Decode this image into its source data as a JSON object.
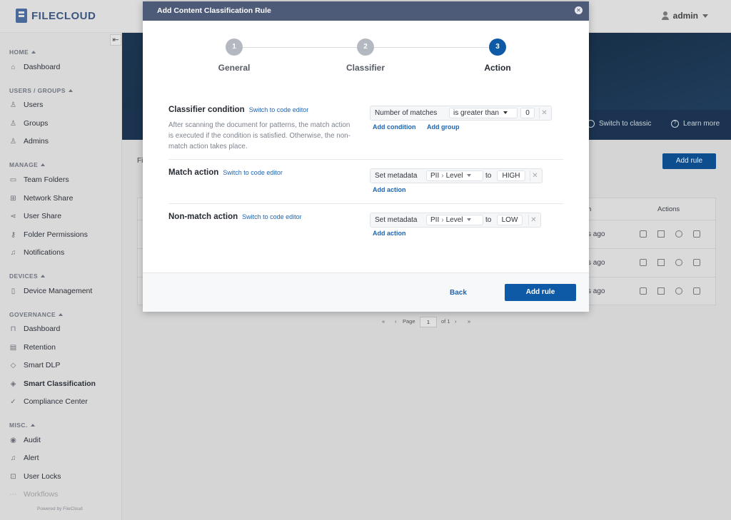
{
  "app": {
    "logo_text": "FILECLOUD",
    "user": "admin"
  },
  "sidebar": {
    "sections": [
      {
        "label": "HOME",
        "items": [
          {
            "label": "Dashboard",
            "icon": "home-icon"
          }
        ]
      },
      {
        "label": "USERS / GROUPS",
        "items": [
          {
            "label": "Users",
            "icon": "user-icon"
          },
          {
            "label": "Groups",
            "icon": "group-icon"
          },
          {
            "label": "Admins",
            "icon": "admin-icon"
          }
        ]
      },
      {
        "label": "MANAGE",
        "items": [
          {
            "label": "Team Folders",
            "icon": "folder-icon"
          },
          {
            "label": "Network Share",
            "icon": "network-icon"
          },
          {
            "label": "User Share",
            "icon": "share-icon"
          },
          {
            "label": "Folder Permissions",
            "icon": "key-icon"
          },
          {
            "label": "Notifications",
            "icon": "bell-icon"
          }
        ]
      },
      {
        "label": "DEVICES",
        "items": [
          {
            "label": "Device Management",
            "icon": "device-icon"
          }
        ]
      },
      {
        "label": "GOVERNANCE",
        "items": [
          {
            "label": "Dashboard",
            "icon": "bank-icon"
          },
          {
            "label": "Retention",
            "icon": "archive-icon"
          },
          {
            "label": "Smart DLP",
            "icon": "shield-icon"
          },
          {
            "label": "Smart Classification",
            "icon": "tag-icon"
          },
          {
            "label": "Compliance Center",
            "icon": "check-icon"
          }
        ]
      },
      {
        "label": "MISC.",
        "items": [
          {
            "label": "Audit",
            "icon": "eye-icon"
          },
          {
            "label": "Alert",
            "icon": "bell-icon"
          },
          {
            "label": "User Locks",
            "icon": "lock-icon"
          },
          {
            "label": "Workflows",
            "icon": "workflow-icon"
          }
        ]
      }
    ],
    "powered_by": "Powered by FileCloud"
  },
  "background": {
    "switch_classic": "Switch to classic",
    "learn_more": "Learn more",
    "add_rule": "Add rule",
    "col_fi": "Fi",
    "col_n": "n",
    "col_actions": "Actions",
    "rows": [
      {
        "ago": "s ago"
      },
      {
        "ago": "s ago"
      },
      {
        "ago": "s ago"
      }
    ],
    "pager": {
      "page_label": "Page",
      "page": "1",
      "of": "of 1"
    }
  },
  "modal": {
    "title": "Add Content Classification Rule",
    "steps": [
      {
        "num": "1",
        "label": "General",
        "state": "done"
      },
      {
        "num": "2",
        "label": "Classifier",
        "state": "done"
      },
      {
        "num": "3",
        "label": "Action",
        "state": "current"
      }
    ],
    "classifier": {
      "title": "Classifier condition",
      "code_link": "Switch to code editor",
      "description": "After scanning the document for patterns, the match action is executed if the condition is satisfied. Otherwise, the non-match action takes place.",
      "field": "Number of matches",
      "operator": "is greater than",
      "value": "0",
      "add_condition": "Add condition",
      "add_group": "Add group"
    },
    "match": {
      "title": "Match action",
      "code_link": "Switch to code editor",
      "action": "Set metadata",
      "set": "PII",
      "attribute": "Level",
      "to": "to",
      "value": "HIGH",
      "add_action": "Add action"
    },
    "nonmatch": {
      "title": "Non-match action",
      "code_link": "Switch to code editor",
      "action": "Set metadata",
      "set": "PII",
      "attribute": "Level",
      "to": "to",
      "value": "LOW",
      "add_action": "Add action"
    },
    "footer": {
      "back": "Back",
      "add_rule": "Add rule"
    }
  },
  "colors": {
    "modal_header": "#4d5a78",
    "primary": "#0e5aa7",
    "link": "#1e64b0",
    "step_done": "#b4b8c0"
  }
}
